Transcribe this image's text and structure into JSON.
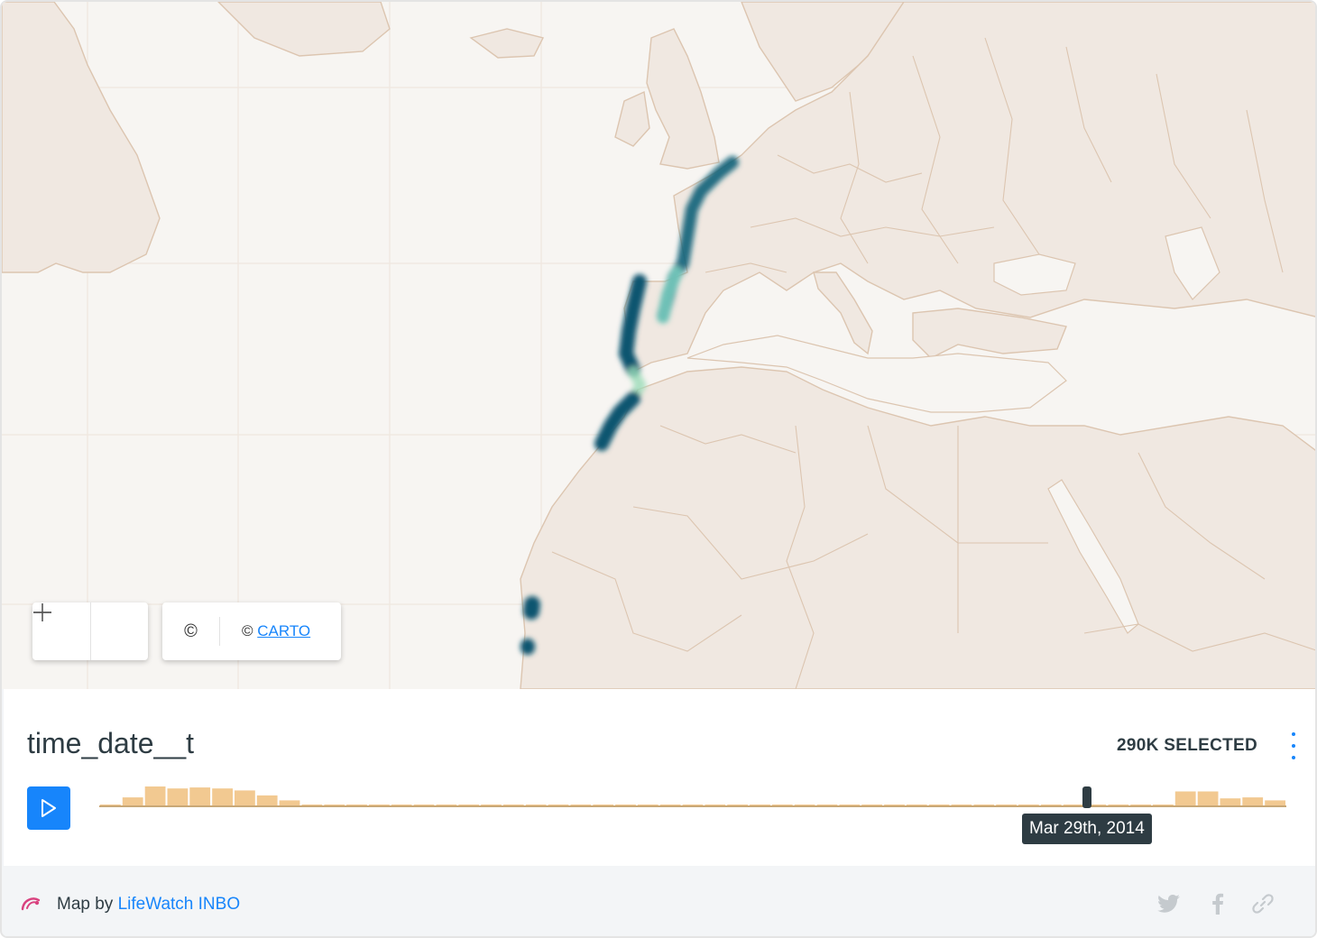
{
  "map": {
    "attribution_symbol": "©",
    "attribution_prefix": "© ",
    "attribution_link": "CARTO"
  },
  "widget": {
    "title": "time_date__t",
    "selected_count": "290K SELECTED",
    "tooltip": "Mar 29th, 2014",
    "histogram_levels": [
      0.05,
      0.45,
      1.0,
      0.9,
      0.95,
      0.9,
      0.8,
      0.55,
      0.3,
      0.05,
      0.05,
      0.05,
      0.05,
      0.05,
      0.05,
      0.05,
      0.05,
      0.05,
      0.05,
      0.05,
      0.05,
      0.05,
      0.05,
      0.05,
      0.05,
      0.05,
      0.05,
      0.05,
      0.05,
      0.05,
      0.05,
      0.05,
      0.05,
      0.05,
      0.05,
      0.05,
      0.05,
      0.05,
      0.05,
      0.05,
      0.05,
      0.05,
      0.05,
      0.05,
      0.05,
      0.05,
      0.05,
      0.05,
      0.75,
      0.75,
      0.4,
      0.45,
      0.3
    ],
    "accent": "#1785fb",
    "bar_color": "#f2c991"
  },
  "footer": {
    "prefix": "Map by ",
    "author": "LifeWatch INBO"
  },
  "icons": [
    "zoom-out-icon",
    "zoom-in-icon",
    "copyright-icon",
    "play-icon",
    "more-vertical-icon",
    "twitter-icon",
    "facebook-icon",
    "link-icon",
    "carto-logo-icon"
  ]
}
